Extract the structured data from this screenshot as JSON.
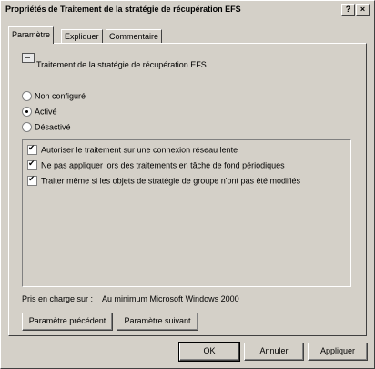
{
  "window": {
    "title": "Propriétés de Traitement de la stratégie de récupération EFS",
    "help_label": "?",
    "close_label": "×"
  },
  "tabs": [
    {
      "label": "Paramètre"
    },
    {
      "label": "Expliquer"
    },
    {
      "label": "Commentaire"
    }
  ],
  "panel": {
    "policy_name": "Traitement de la stratégie de récupération EFS",
    "radios": [
      {
        "label": "Non configuré",
        "checked": false
      },
      {
        "label": "Activé",
        "checked": true
      },
      {
        "label": "Désactivé",
        "checked": false
      }
    ],
    "options": [
      {
        "label": "Autoriser le traitement sur une connexion réseau lente",
        "checked": true
      },
      {
        "label": "Ne pas appliquer lors des traitements en tâche de fond périodiques",
        "checked": true
      },
      {
        "label": "Traiter même si les objets de stratégie de groupe n'ont pas été modifiés",
        "checked": true
      }
    ],
    "supported_label": "Pris en charge sur :",
    "supported_value": "Au minimum Microsoft Windows 2000",
    "prev_label": "Paramètre précédent",
    "next_label": "Paramètre suivant"
  },
  "footer": {
    "ok_label": "OK",
    "cancel_label": "Annuler",
    "apply_label": "Appliquer"
  }
}
